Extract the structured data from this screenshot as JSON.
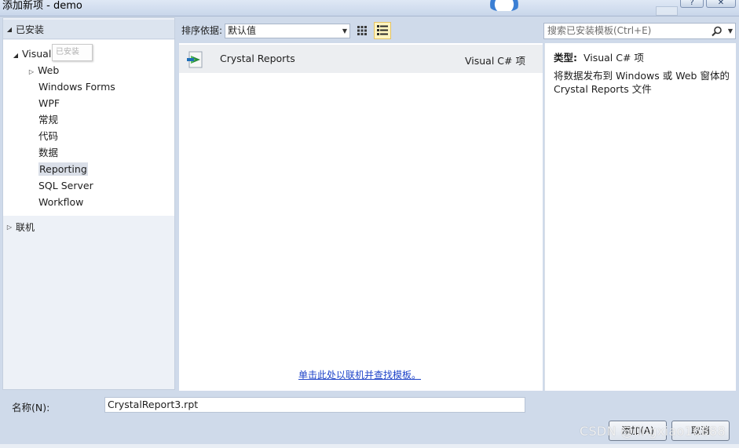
{
  "window": {
    "title": "添加新项 - demo",
    "help_label": "?",
    "close_label": "✕"
  },
  "left_panel": {
    "installed_header": "已安装",
    "tree": [
      {
        "label": "Visual C# 项",
        "level": 1,
        "expanded": true
      },
      {
        "label": "Web",
        "level": 2,
        "collapsed": true
      },
      {
        "label": "Windows Forms",
        "level": 2
      },
      {
        "label": "WPF",
        "level": 2
      },
      {
        "label": "常规",
        "level": 2
      },
      {
        "label": "代码",
        "level": 2
      },
      {
        "label": "数据",
        "level": 2
      },
      {
        "label": "Reporting",
        "level": 2,
        "selected": true
      },
      {
        "label": "SQL Server",
        "level": 2
      },
      {
        "label": "Workflow",
        "level": 2
      }
    ],
    "tooltip": "已安装",
    "online_header": "联机"
  },
  "toolbar": {
    "sort_label": "排序依据:",
    "sort_value": "默认值",
    "search_placeholder": "搜索已安装模板(Ctrl+E)"
  },
  "templates": [
    {
      "name": "Crystal Reports",
      "type": "Visual C# 项",
      "selected": true
    }
  ],
  "online_link": "单击此处以联机并查找模板。",
  "details": {
    "type_label": "类型:",
    "type_value": "Visual C# 项",
    "description": "将数据发布到 Windows 或 Web 窗体的 Crystal Reports 文件"
  },
  "bottom": {
    "name_label": "名称(N):",
    "name_value": "CrystalReport3.rpt",
    "add_label": "添加(A)",
    "cancel_label": "取消"
  },
  "watermark": "CSDN @lingxiao16888"
}
